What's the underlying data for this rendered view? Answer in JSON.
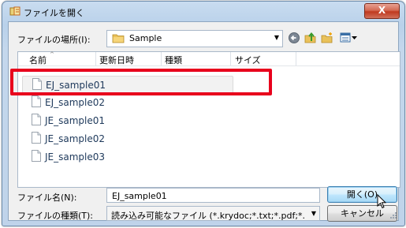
{
  "window": {
    "title": "ファイルを開く",
    "close_label": "X"
  },
  "lookin": {
    "label": "ファイルの場所(I):",
    "value": "Sample"
  },
  "columns": [
    "名前",
    "更新日時",
    "種類",
    "サイズ"
  ],
  "files": [
    {
      "name": "EJ_sample01",
      "selected": true
    },
    {
      "name": "EJ_sample02",
      "selected": false
    },
    {
      "name": "JE_sample01",
      "selected": false
    },
    {
      "name": "JE_sample02",
      "selected": false
    },
    {
      "name": "JE_sample03",
      "selected": false
    }
  ],
  "filename": {
    "label": "ファイル名(N):",
    "value": "EJ_sample01"
  },
  "filetype": {
    "label": "ファイルの種類(T):",
    "value": "読み込み可能なファイル (*.krydoc;*.txt;*.pdf;*.htm;"
  },
  "buttons": {
    "open": "開く(O)",
    "cancel": "キャンセル"
  },
  "colors": {
    "highlight": "#e8001c",
    "title_bg": "#b9d1ea"
  },
  "icons": [
    "app-icon",
    "folder-icon",
    "back-icon",
    "up-folder-icon",
    "new-folder-icon",
    "view-menu-icon",
    "file-icon",
    "mouse-cursor-icon"
  ]
}
